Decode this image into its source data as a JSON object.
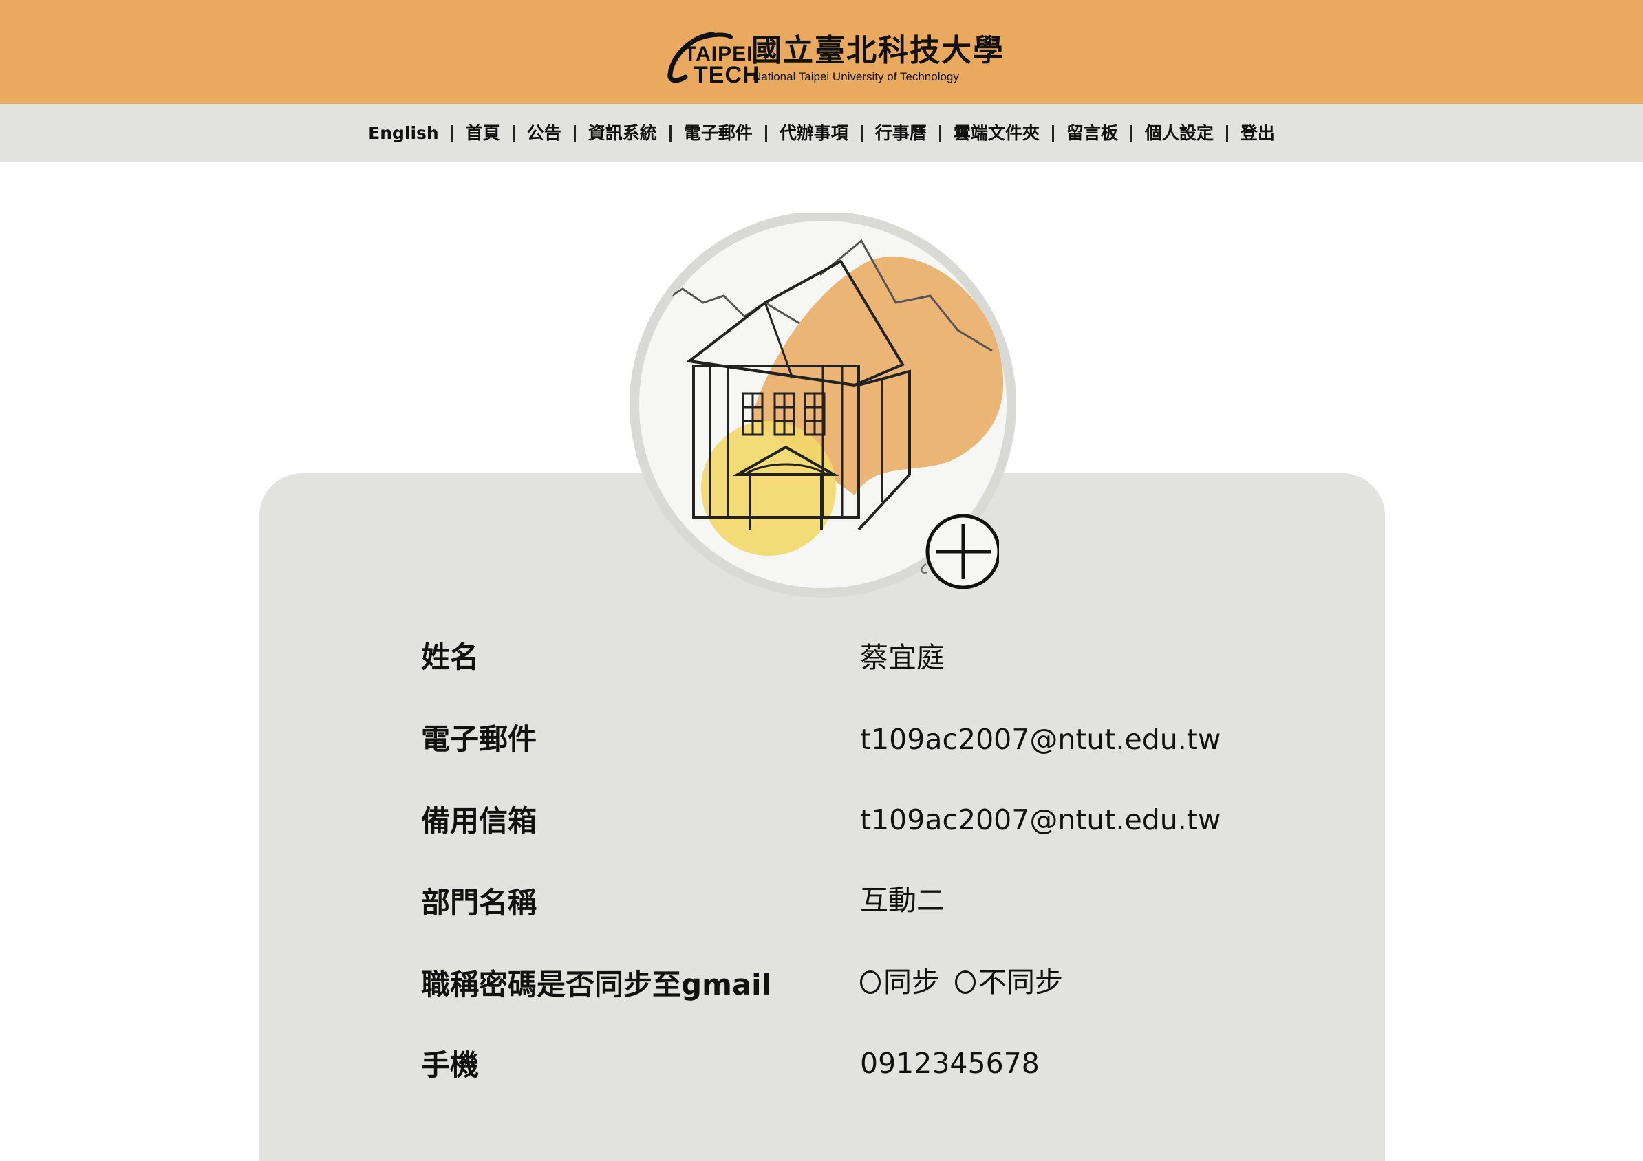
{
  "header": {
    "logo_en_line1": "TAIPEI",
    "logo_en_line2": "TECH",
    "logo_zh": "國立臺北科技大學",
    "logo_sub": "National Taipei University of Technology",
    "bg_color": "#e9a95e"
  },
  "nav": {
    "items": [
      {
        "label": "English"
      },
      {
        "label": "首頁"
      },
      {
        "label": "公告"
      },
      {
        "label": "資訊系統"
      },
      {
        "label": "電子郵件"
      },
      {
        "label": "代辦事項"
      },
      {
        "label": "行事曆"
      },
      {
        "label": "雲端文件夾"
      },
      {
        "label": "留言板"
      },
      {
        "label": "個人設定"
      },
      {
        "label": "登出"
      }
    ]
  },
  "avatar": {
    "image": "school-building-illustration",
    "add_icon": "plus-circle-icon"
  },
  "profile": {
    "name_label": "姓名",
    "name_value": "蔡宜庭",
    "email_label": "電子郵件",
    "email_value": "t109ac2007@ntut.edu.tw",
    "backup_email_label": "備用信箱",
    "backup_email_value": "t109ac2007@ntut.edu.tw",
    "department_label": "部門名稱",
    "department_value": "互動二",
    "sync_label": "職稱密碼是否同步至gmail",
    "sync_option_yes": "同步",
    "sync_option_no": "不同步",
    "phone_label": "手機",
    "phone_value": "0912345678"
  }
}
